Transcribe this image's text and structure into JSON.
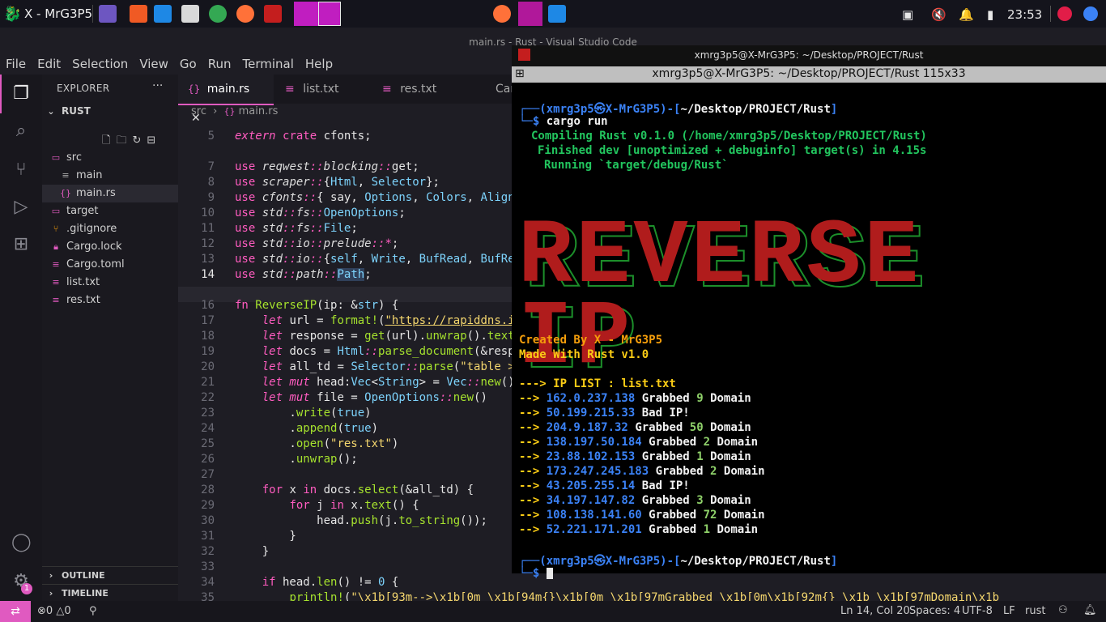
{
  "panel": {
    "window_title": "X - MrG3P5",
    "clock": "23:53"
  },
  "vscode": {
    "title": "main.rs - Rust - Visual Studio Code",
    "menu": [
      "File",
      "Edit",
      "Selection",
      "View",
      "Go",
      "Run",
      "Terminal",
      "Help"
    ],
    "explorer_label": "EXPLORER",
    "project": "RUST",
    "tree": [
      {
        "name": "src",
        "kind": "folder"
      },
      {
        "name": "main",
        "kind": "file"
      },
      {
        "name": "main.rs",
        "kind": "rs"
      },
      {
        "name": "target",
        "kind": "folder"
      },
      {
        "name": ".gitignore",
        "kind": "git"
      },
      {
        "name": "Cargo.lock",
        "kind": "lock"
      },
      {
        "name": "Cargo.toml",
        "kind": "file"
      },
      {
        "name": "list.txt",
        "kind": "file"
      },
      {
        "name": "res.txt",
        "kind": "file"
      }
    ],
    "outline": "OUTLINE",
    "timeline": "TIMELINE",
    "tabs": [
      "main.rs",
      "list.txt",
      "res.txt",
      "Car"
    ],
    "breadcrumb": {
      "folder": "src",
      "file": "main.rs"
    },
    "line_numbers": [
      "5",
      "",
      "7",
      "8",
      "9",
      "10",
      "11",
      "12",
      "13",
      "14",
      "",
      "16",
      "17",
      "18",
      "19",
      "20",
      "21",
      "22",
      "23",
      "24",
      "25",
      "26",
      "27",
      "28",
      "29",
      "30",
      "31",
      "32",
      "33",
      "34",
      "35"
    ],
    "status": {
      "errors": "0",
      "warnings": "0",
      "position": "Ln 14, Col 20",
      "spaces": "Spaces: 4",
      "encoding": "UTF-8",
      "eol": "LF",
      "language": "rust"
    }
  },
  "terminal": {
    "title": "xmrg3p5@X-MrG3P5: ~/Desktop/PROJECT/Rust",
    "subtitle": "xmrg3p5@X-MrG3P5: ~/Desktop/PROJECT/Rust 115x33",
    "user": "xmrg3p5",
    "host": "X-MrG3P5",
    "cwd": "~/Desktop/PROJECT/Rust",
    "command": "cargo run",
    "compiling": "Compiling Rust v0.1.0 (/home/xmrg3p5/Desktop/PROJECT/Rust)",
    "finished": "Finished dev [unoptimized + debuginfo] target(s) in 4.15s",
    "running": "Running `target/debug/Rust`",
    "banner": "REVERSE IP",
    "created_by": "Created By X - MrG3P5",
    "made_with": "Made With Rust v1.0",
    "ip_list_label": "---> IP LIST : list.txt",
    "results": [
      {
        "ip": "162.0.237.138",
        "status": "Grabbed",
        "count": "9",
        "unit": "Domain"
      },
      {
        "ip": "50.199.215.33",
        "status": "Bad IP!",
        "count": "",
        "unit": ""
      },
      {
        "ip": "204.9.187.32",
        "status": "Grabbed",
        "count": "50",
        "unit": "Domain"
      },
      {
        "ip": "138.197.50.184",
        "status": "Grabbed",
        "count": "2",
        "unit": "Domain"
      },
      {
        "ip": "23.88.102.153",
        "status": "Grabbed",
        "count": "1",
        "unit": "Domain"
      },
      {
        "ip": "173.247.245.183",
        "status": "Grabbed",
        "count": "2",
        "unit": "Domain"
      },
      {
        "ip": "43.205.255.14",
        "status": "Bad IP!",
        "count": "",
        "unit": ""
      },
      {
        "ip": "34.197.147.82",
        "status": "Grabbed",
        "count": "3",
        "unit": "Domain"
      },
      {
        "ip": "108.138.141.60",
        "status": "Grabbed",
        "count": "72",
        "unit": "Domain"
      },
      {
        "ip": "52.221.171.201",
        "status": "Grabbed",
        "count": "1",
        "unit": "Domain"
      }
    ]
  },
  "colors": {
    "accent": "#e05ac0",
    "banner_red": "#b01c1c",
    "banner_green": "#1c8f2a"
  }
}
